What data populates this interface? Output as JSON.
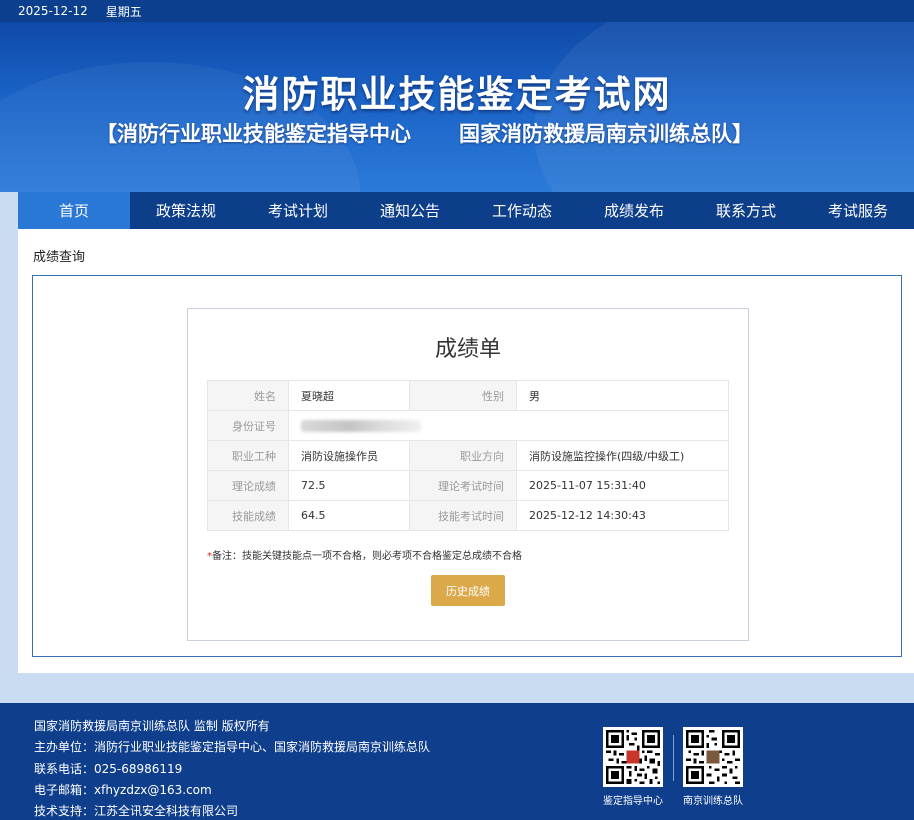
{
  "topbar": {
    "date": "2025-12-12",
    "weekday": "星期五"
  },
  "banner": {
    "title": "消防职业技能鉴定考试网",
    "subtitle_left": "【消防行业职业技能鉴定指导中心",
    "subtitle_right": "国家消防救援局南京训练总队】"
  },
  "nav": {
    "items": [
      "首页",
      "政策法规",
      "考试计划",
      "通知公告",
      "工作动态",
      "成绩发布",
      "联系方式",
      "考试服务"
    ],
    "active": "首页"
  },
  "breadcrumb": "成绩查询",
  "report": {
    "title": "成绩单",
    "rows": {
      "name_label": "姓名",
      "name_value": "夏晓超",
      "gender_label": "性别",
      "gender_value": "男",
      "id_label": "身份证号",
      "id_value": "",
      "job_label": "职业工种",
      "job_value": "消防设施操作员",
      "direction_label": "职业方向",
      "direction_value": "消防设施监控操作(四级/中级工)",
      "theory_label": "理论成绩",
      "theory_value": "72.5",
      "theory_time_label": "理论考试时间",
      "theory_time_value": "2025-11-07 15:31:40",
      "skill_label": "技能成绩",
      "skill_value": "64.5",
      "skill_time_label": "技能考试时间",
      "skill_time_value": "2025-12-12 14:30:43"
    },
    "note_star": "*",
    "note_text": "备注：技能关键技能点一项不合格，则必考项不合格鉴定总成绩不合格",
    "history_button": "历史成绩"
  },
  "footer": {
    "line1": "国家消防救援局南京训练总队 监制 版权所有",
    "line2": "主办单位：消防行业职业技能鉴定指导中心、国家消防救援局南京训练总队",
    "line3": "联系电话：025-68986119",
    "line4": "电子邮箱：xfhyzdzx@163.com",
    "line5": "技术支持：江苏全讯安全科技有限公司",
    "qr1_label": "鉴定指导中心",
    "qr2_label": "南京训练总队"
  },
  "icons": {
    "qr1": "qr-code-icon",
    "qr2": "qr-code-icon"
  },
  "colors": {
    "nav_bg": "#0d3e8a",
    "nav_active": "#2a78d6",
    "button": "#dba84a",
    "footer_bg": "#0f3f8c",
    "skill_score": "#3a8fc5"
  }
}
